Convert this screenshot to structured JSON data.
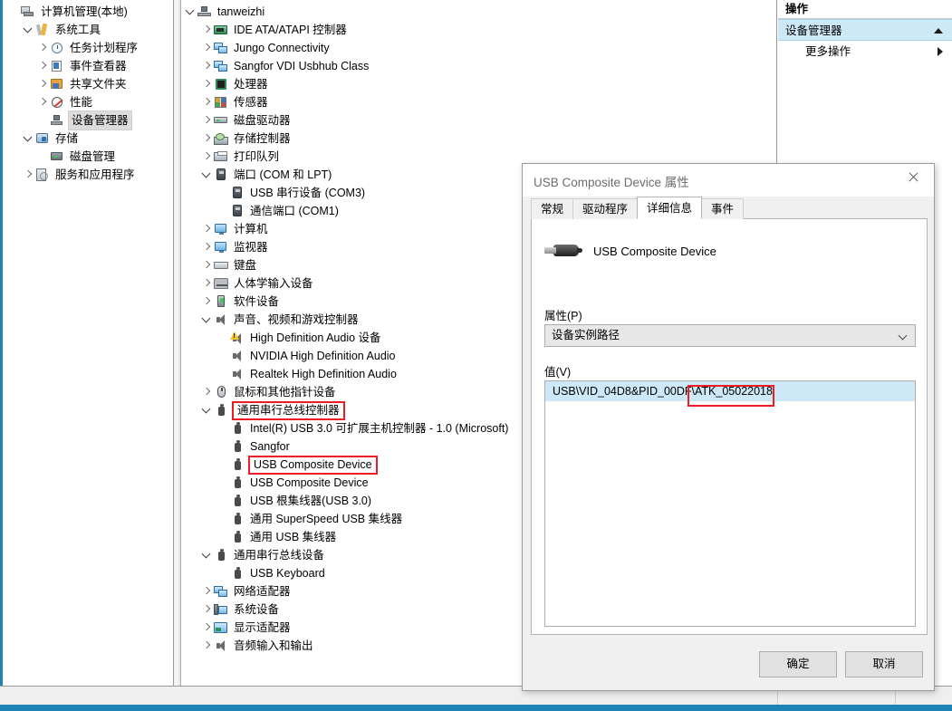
{
  "window": {
    "accent_color": "#1f83b5"
  },
  "tree_pane": {
    "items": [
      {
        "label": "计算机管理(本地)",
        "indent": 0,
        "chev": "none",
        "icon": "computer-management-icon"
      },
      {
        "label": "系统工具",
        "indent": 1,
        "chev": "open",
        "icon": "system-tools-icon"
      },
      {
        "label": "任务计划程序",
        "indent": 2,
        "chev": "closed",
        "icon": "task-scheduler-icon"
      },
      {
        "label": "事件查看器",
        "indent": 2,
        "chev": "closed",
        "icon": "event-viewer-icon"
      },
      {
        "label": "共享文件夹",
        "indent": 2,
        "chev": "closed",
        "icon": "shared-folders-icon"
      },
      {
        "label": "性能",
        "indent": 2,
        "chev": "closed",
        "icon": "performance-icon"
      },
      {
        "label": "设备管理器",
        "indent": 2,
        "chev": "none",
        "icon": "device-manager-icon",
        "selected": true
      },
      {
        "label": "存储",
        "indent": 1,
        "chev": "open",
        "icon": "storage-icon"
      },
      {
        "label": "磁盘管理",
        "indent": 2,
        "chev": "none",
        "icon": "disk-management-icon"
      },
      {
        "label": "服务和应用程序",
        "indent": 1,
        "chev": "closed",
        "icon": "services-and-applications-icon"
      }
    ]
  },
  "device_tree": {
    "items": [
      {
        "label": "tanweizhi",
        "indent": 0,
        "chev": "open",
        "icon": "computer-node-icon"
      },
      {
        "label": "IDE ATA/ATAPI 控制器",
        "indent": 1,
        "chev": "closed",
        "icon": "ide-controller-icon"
      },
      {
        "label": "Jungo Connectivity",
        "indent": 1,
        "chev": "closed",
        "icon": "network-class-icon"
      },
      {
        "label": "Sangfor VDI Usbhub Class",
        "indent": 1,
        "chev": "closed",
        "icon": "network-class-icon"
      },
      {
        "label": "处理器",
        "indent": 1,
        "chev": "closed",
        "icon": "processor-icon"
      },
      {
        "label": "传感器",
        "indent": 1,
        "chev": "closed",
        "icon": "sensor-icon"
      },
      {
        "label": "磁盘驱动器",
        "indent": 1,
        "chev": "closed",
        "icon": "disk-drive-icon"
      },
      {
        "label": "存储控制器",
        "indent": 1,
        "chev": "closed",
        "icon": "storage-controller-icon"
      },
      {
        "label": "打印队列",
        "indent": 1,
        "chev": "closed",
        "icon": "print-queue-icon"
      },
      {
        "label": "端口 (COM 和 LPT)",
        "indent": 1,
        "chev": "open",
        "icon": "port-icon"
      },
      {
        "label": "USB 串行设备 (COM3)",
        "indent": 2,
        "chev": "none",
        "icon": "port-icon"
      },
      {
        "label": "通信端口 (COM1)",
        "indent": 2,
        "chev": "none",
        "icon": "port-icon"
      },
      {
        "label": "计算机",
        "indent": 1,
        "chev": "closed",
        "icon": "monitor-icon"
      },
      {
        "label": "监视器",
        "indent": 1,
        "chev": "closed",
        "icon": "monitor-icon"
      },
      {
        "label": "键盘",
        "indent": 1,
        "chev": "closed",
        "icon": "keyboard-icon"
      },
      {
        "label": "人体学输入设备",
        "indent": 1,
        "chev": "closed",
        "icon": "hid-icon"
      },
      {
        "label": "软件设备",
        "indent": 1,
        "chev": "closed",
        "icon": "software-device-icon"
      },
      {
        "label": "声音、视频和游戏控制器",
        "indent": 1,
        "chev": "open",
        "icon": "speaker-icon"
      },
      {
        "label": "High Definition Audio 设备",
        "indent": 2,
        "chev": "none",
        "icon": "speaker-warning-icon"
      },
      {
        "label": "NVIDIA High Definition Audio",
        "indent": 2,
        "chev": "none",
        "icon": "speaker-icon"
      },
      {
        "label": "Realtek High Definition Audio",
        "indent": 2,
        "chev": "none",
        "icon": "speaker-icon"
      },
      {
        "label": "鼠标和其他指针设备",
        "indent": 1,
        "chev": "closed",
        "icon": "mouse-icon"
      },
      {
        "label": "通用串行总线控制器",
        "indent": 1,
        "chev": "open",
        "icon": "usb-icon",
        "highlight": true
      },
      {
        "label": "Intel(R) USB 3.0 可扩展主机控制器 - 1.0 (Microsoft)",
        "indent": 2,
        "chev": "none",
        "icon": "usb-icon"
      },
      {
        "label": "Sangfor",
        "indent": 2,
        "chev": "none",
        "icon": "usb-icon"
      },
      {
        "label": "USB Composite Device",
        "indent": 2,
        "chev": "none",
        "icon": "usb-icon",
        "highlight": true
      },
      {
        "label": "USB Composite Device",
        "indent": 2,
        "chev": "none",
        "icon": "usb-icon"
      },
      {
        "label": "USB 根集线器(USB 3.0)",
        "indent": 2,
        "chev": "none",
        "icon": "usb-icon"
      },
      {
        "label": "通用 SuperSpeed USB 集线器",
        "indent": 2,
        "chev": "none",
        "icon": "usb-icon"
      },
      {
        "label": "通用 USB 集线器",
        "indent": 2,
        "chev": "none",
        "icon": "usb-icon"
      },
      {
        "label": "通用串行总线设备",
        "indent": 1,
        "chev": "open",
        "icon": "usb-icon"
      },
      {
        "label": "USB Keyboard",
        "indent": 2,
        "chev": "none",
        "icon": "usb-icon"
      },
      {
        "label": "网络适配器",
        "indent": 1,
        "chev": "closed",
        "icon": "network-adapter-icon"
      },
      {
        "label": "系统设备",
        "indent": 1,
        "chev": "closed",
        "icon": "system-device-icon"
      },
      {
        "label": "显示适配器",
        "indent": 1,
        "chev": "closed",
        "icon": "display-adapter-icon"
      },
      {
        "label": "音频输入和输出",
        "indent": 1,
        "chev": "closed",
        "icon": "speaker-icon"
      }
    ]
  },
  "actions_pane": {
    "header": "操作",
    "selected_item": "设备管理器",
    "sub_item": "更多操作"
  },
  "dialog": {
    "title": "USB Composite Device 属性",
    "tabs": [
      {
        "label": "常规",
        "active": false
      },
      {
        "label": "驱动程序",
        "active": false
      },
      {
        "label": "详细信息",
        "active": true
      },
      {
        "label": "事件",
        "active": false
      }
    ],
    "device_name": "USB Composite Device",
    "property_label": "属性(P)",
    "property_value": "设备实例路径",
    "value_label": "值(V)",
    "value_entry": "USB\\VID_04D8&PID_00DF\\ATK_05022018",
    "highlight_color": "#ee1c25",
    "ok_button": "确定",
    "cancel_button": "取消"
  }
}
